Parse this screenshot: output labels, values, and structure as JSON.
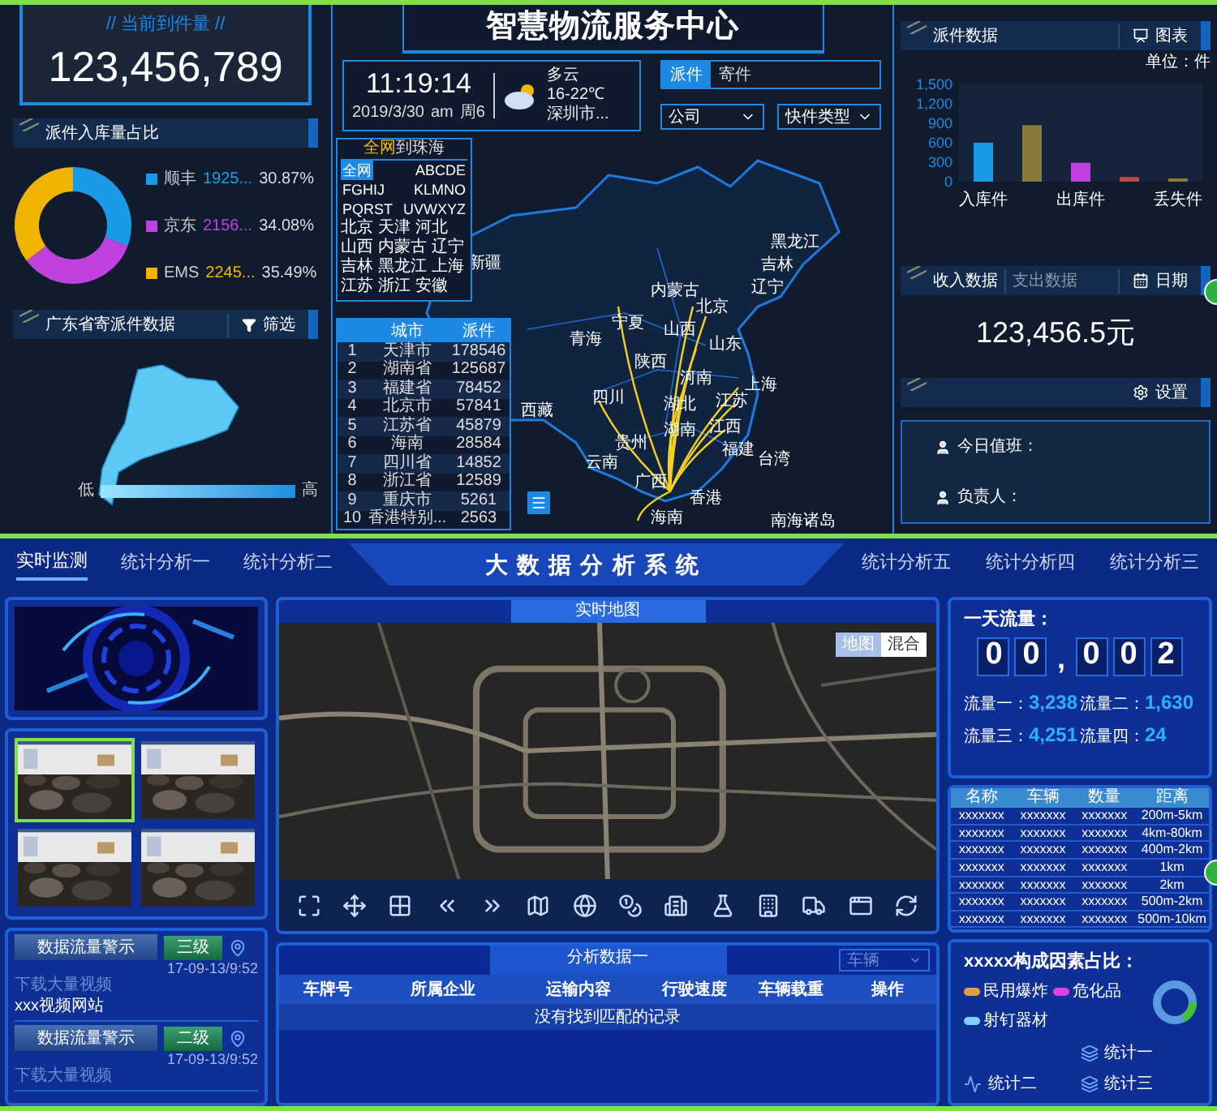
{
  "top": {
    "arrivals": {
      "title": "// 当前到件量 //",
      "value": "123,456,789"
    },
    "share_section": {
      "title": "派件入库量占比"
    },
    "share_legend": [
      {
        "amount": "1925...",
        "percent": "30.87%",
        "color": "#1a9be8"
      },
      {
        "amount": "2156...",
        "percent": "34.08%",
        "color": "#c040e0"
      },
      {
        "amount": "2245...",
        "percent": "35.49%",
        "color": "#f0b400"
      }
    ],
    "share_chart": {
      "chart_data": {
        "type": "donut",
        "categories": [
          "顺丰",
          "京东",
          "EMS"
        ],
        "values": [
          30.87,
          34.08,
          35.49
        ]
      }
    },
    "guangdong_section": {
      "title": "广东省寄派件数据",
      "filter_button": "筛选"
    },
    "gradient_legend": {
      "low": "低",
      "high": "高"
    },
    "title": "智慧物流服务中心",
    "clock": {
      "time": "11:19:14",
      "date": "2019/3/30",
      "ampm": "am",
      "weekday": "周6"
    },
    "weather": {
      "condition": "多云",
      "temperature": "16-22℃",
      "city": "深圳市..."
    },
    "mode_tabs": [
      {
        "label": "派件",
        "selected": true
      },
      {
        "label": "寄件",
        "selected": false
      }
    ],
    "dropdowns": [
      {
        "label": "公司"
      },
      {
        "label": "快件类型"
      }
    ],
    "route_picker": {
      "origin": "全网",
      "destination": "到珠海",
      "letter_filters": [
        {
          "label": "全网",
          "selected": true
        },
        {
          "label": "ABCDE",
          "selected": false
        },
        {
          "label": "FGHIJ",
          "selected": false
        },
        {
          "label": "KLMNO",
          "selected": false
        },
        {
          "label": "PQRST",
          "selected": false
        },
        {
          "label": "UVWXYZ",
          "selected": false
        }
      ],
      "provinces": [
        "北京",
        "天津",
        "河北",
        "山西",
        "内蒙古",
        "辽宁",
        "吉林",
        "黑龙江",
        "上海",
        "江苏",
        "浙江",
        "安徽"
      ]
    },
    "city_table": {
      "columns": [
        "",
        "城市",
        "派件"
      ],
      "rows": [
        [
          "1",
          "天津市",
          "178546"
        ],
        [
          "2",
          "湖南省",
          "125687"
        ],
        [
          "3",
          "福建省",
          "78452"
        ],
        [
          "4",
          "北京市",
          "57841"
        ],
        [
          "5",
          "江苏省",
          "45879"
        ],
        [
          "6",
          "海南",
          "28584"
        ],
        [
          "7",
          "四川省",
          "14852"
        ],
        [
          "8",
          "浙江省",
          "12589"
        ],
        [
          "9",
          "重庆市",
          "5261"
        ],
        [
          "10",
          "香港特别...",
          "2563"
        ]
      ]
    },
    "map_labels": [
      "新疆",
      "黑龙江",
      "吉林",
      "辽宁",
      "内蒙古",
      "北京",
      "宁夏",
      "山西",
      "青海",
      "山东",
      "陕西",
      "河南",
      "西藏",
      "四川",
      "江苏",
      "上海",
      "湖北",
      "湖南",
      "江西",
      "贵州",
      "福建",
      "云南",
      "台湾",
      "广西",
      "香港",
      "海南",
      "南海诸岛"
    ],
    "parcel_section": {
      "title": "派件数据",
      "chart_button": "图表",
      "unit": "单位：件",
      "chart_data": {
        "type": "bar",
        "categories": [
          "入库件",
          null,
          "出库件",
          null,
          "丢失件"
        ],
        "series": [
          {
            "color": "#1a9be8",
            "values": [
              600,
              null,
              null,
              null,
              null
            ]
          },
          {
            "color": "#8a7a3a",
            "values": [
              null,
              870,
              null,
              null,
              null
            ]
          },
          {
            "color": "#c040e0",
            "values": [
              null,
              null,
              290,
              null,
              null
            ]
          },
          {
            "color": "#c04848",
            "values": [
              null,
              null,
              null,
              70,
              null
            ]
          },
          {
            "color": "#8a7a3a",
            "values": [
              null,
              null,
              null,
              null,
              50
            ]
          }
        ],
        "ylim": [
          0,
          1500
        ],
        "yticks": [
          0,
          300,
          600,
          900,
          {
            "value": 1200,
            "label": "1,200"
          },
          {
            "value": 1500,
            "label": "1,500"
          }
        ]
      }
    },
    "finance": {
      "tabs": [
        {
          "label": "收入数据",
          "selected": true
        },
        {
          "label": "支出数据",
          "selected": false
        }
      ],
      "date_button": "日期",
      "amount": "123,456.5元"
    },
    "duty": {
      "settings_button": "设置",
      "fields": [
        "今日值班：",
        "负责人："
      ]
    }
  },
  "bottom": {
    "nav": {
      "title": "大数据分析系统",
      "left_tabs": [
        {
          "label": "实时监测",
          "selected": true
        },
        {
          "label": "统计分析一",
          "selected": false
        },
        {
          "label": "统计分析二",
          "selected": false
        }
      ],
      "right_tabs": [
        {
          "label": "统计分析五",
          "selected": false
        },
        {
          "label": "统计分析四",
          "selected": false
        },
        {
          "label": "统计分析三",
          "selected": false
        }
      ]
    },
    "video_feeds": [
      {
        "selected": true
      },
      {
        "selected": false
      },
      {
        "selected": false
      },
      {
        "selected": false
      }
    ],
    "alerts": [
      {
        "button": "数据流量警示",
        "level": "三级",
        "time": "17-09-13/9:52",
        "lines": [
          "下载大量视频",
          "xxx视频网站"
        ]
      },
      {
        "button": "数据流量警示",
        "level": "二级",
        "time": "17-09-13/9:52",
        "lines": [
          "下载大量视频"
        ]
      }
    ],
    "live_map": {
      "title": "实时地图",
      "map_types": [
        {
          "label": "地图",
          "selected": true
        },
        {
          "label": "混合",
          "selected": false
        }
      ]
    },
    "analysis": {
      "title": "分析数据一",
      "filter": "车辆",
      "columns": [
        "车牌号",
        "所属企业",
        "运输内容",
        "行驶速度",
        "车辆载重",
        "操作"
      ],
      "empty_message": "没有找到匹配的记录"
    },
    "traffic": {
      "title": "一天流量：",
      "digits": [
        {
          "kind": "digit",
          "text": "0"
        },
        {
          "kind": "digit",
          "text": "0"
        },
        {
          "kind": "separator",
          "text": ","
        },
        {
          "kind": "digit",
          "text": "0"
        },
        {
          "kind": "digit",
          "text": "0"
        },
        {
          "kind": "digit",
          "text": "2"
        }
      ],
      "flows": [
        {
          "label": "流量一：",
          "value": "3,238"
        },
        {
          "label": "流量二：",
          "value": "1,630"
        },
        {
          "label": "流量三：",
          "value": "4,251"
        },
        {
          "label": "流量四：",
          "value": "24"
        }
      ]
    },
    "range_table": {
      "columns": [
        "名称",
        "车辆",
        "数量",
        "距离"
      ],
      "rows": [
        [
          "xxxxxxx",
          "xxxxxxx",
          "xxxxxxx",
          "200m-5km"
        ],
        [
          "xxxxxxx",
          "xxxxxxx",
          "xxxxxxx",
          "4km-80km"
        ],
        [
          "xxxxxxx",
          "xxxxxxx",
          "xxxxxxx",
          "400m-2km"
        ],
        [
          "xxxxxxx",
          "xxxxxxx",
          "xxxxxxx",
          "1km"
        ],
        [
          "xxxxxxx",
          "xxxxxxx",
          "xxxxxxx",
          "2km"
        ],
        [
          "xxxxxxx",
          "xxxxxxx",
          "xxxxxxx",
          "500m-2km"
        ],
        [
          "xxxxxxx",
          "xxxxxxx",
          "xxxxxxx",
          "500m-10km"
        ]
      ]
    },
    "factors": {
      "title": "xxxxx构成因素占比：",
      "legend": [
        {
          "label": "民用爆炸",
          "color": "#e0a040"
        },
        {
          "label": "危化品",
          "color": "#e040e0"
        },
        {
          "label": "射钉器材",
          "color": "#80d0ff"
        }
      ],
      "stats": [
        "统计一",
        "统计二",
        "统计三"
      ]
    }
  }
}
